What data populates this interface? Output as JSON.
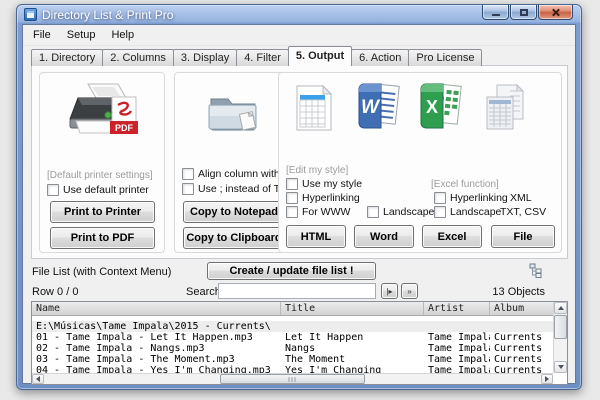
{
  "window": {
    "title": "Directory List & Print Pro"
  },
  "menu": {
    "items": [
      "File",
      "Setup",
      "Help"
    ]
  },
  "tabs": [
    "1. Directory",
    "2. Columns",
    "3. Display",
    "4. Filter",
    "5. Output",
    "6. Action",
    "Pro License"
  ],
  "printer_group": {
    "settings_label": "[Default printer settings]",
    "use_default_checkbox": "Use default printer",
    "print_printer_button": "Print to Printer",
    "print_pdf_button": "Print to PDF",
    "pdf_badge": "PDF"
  },
  "notepad_group": {
    "align_checkbox": "Align column with blanks",
    "semicolon_checkbox": "Use ; instead of TAB",
    "copy_notepad_button": "Copy to Notepad",
    "copy_clipboard_button": "Copy to Clipboard"
  },
  "style_group": {
    "edit_style_label": "[Edit my style]",
    "use_my_style_checkbox": "Use my style",
    "hyperlinking_checkbox": "Hyperlinking",
    "for_www_checkbox": "For WWW",
    "landscape_www_checkbox": "Landscape",
    "excel_function_label": "[Excel function]",
    "excel_hyperlinking_checkbox": "Hyperlinking",
    "excel_landscape_checkbox": "Landscape",
    "xml_label": "XML",
    "txt_csv_label": "TXT, CSV",
    "html_button": "HTML",
    "word_button": "Word",
    "excel_button": "Excel",
    "file_button": "File",
    "word_letter": "W",
    "excel_letter": "X"
  },
  "file_list_bar": {
    "label": "File List (with Context Menu)",
    "create_button": "Create / update file list !"
  },
  "search_bar": {
    "row_counter": "Row 0 / 0",
    "search_label": "Search",
    "search_value": "",
    "goto_button": "|▸",
    "more_button": "»",
    "objects_count": "13 Objects"
  },
  "table": {
    "columns": [
      "Name",
      "Title",
      "Artist",
      "Album"
    ],
    "rows": [
      {
        "name": "E:\\Músicas\\Tame Impala\\2015 - Currents\\",
        "title": "",
        "artist": "",
        "album": "",
        "is_dir": true
      },
      {
        "name": "01 - Tame Impala - Let It Happen.mp3",
        "title": "Let It Happen",
        "artist": "Tame Impala",
        "album": "Currents",
        "is_dir": false
      },
      {
        "name": "02 - Tame Impala - Nangs.mp3",
        "title": "Nangs",
        "artist": "Tame Impala",
        "album": "Currents",
        "is_dir": false
      },
      {
        "name": "03 - Tame Impala - The Moment.mp3",
        "title": "The Moment",
        "artist": "Tame Impala",
        "album": "Currents",
        "is_dir": false
      },
      {
        "name": "04 - Tame Impala - Yes I'm Changing.mp3",
        "title": "Yes I'm Changing",
        "artist": "Tame Impala",
        "album": "Currents",
        "is_dir": false
      }
    ]
  },
  "colors": {
    "titlebar_blue": "#7d9cd1",
    "close_red": "#c75f41",
    "pdf_red": "#cc2229",
    "word_blue": "#2c5d9e",
    "excel_green": "#217346"
  }
}
